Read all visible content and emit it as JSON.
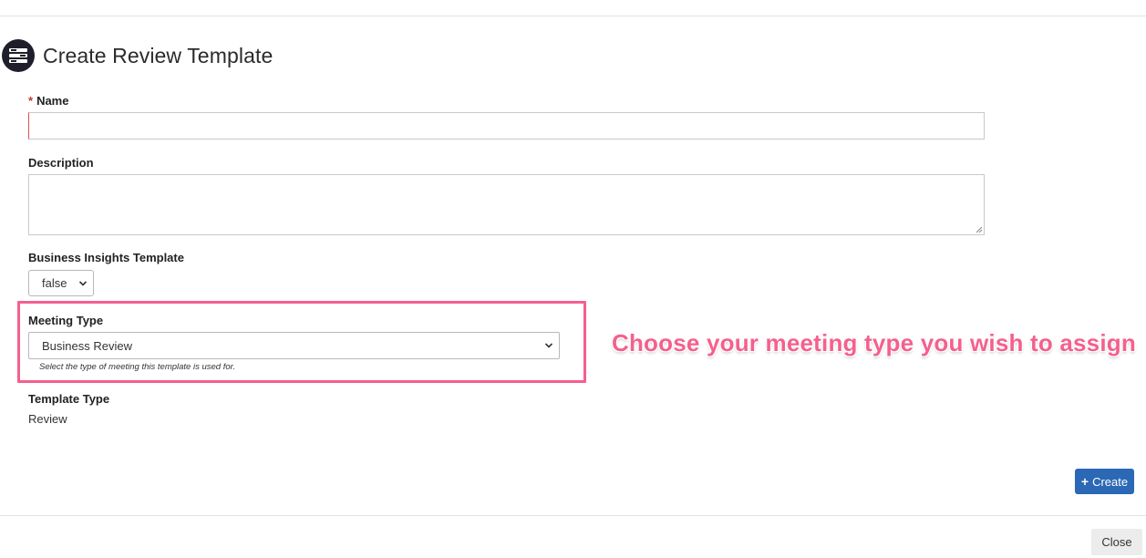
{
  "header": {
    "title": "Create Review Template",
    "icon": "list-stack-icon"
  },
  "form": {
    "name": {
      "required_marker": "*",
      "label": "Name",
      "value": ""
    },
    "description": {
      "label": "Description",
      "value": ""
    },
    "business_insights": {
      "label": "Business Insights Template",
      "selected": "false"
    },
    "meeting_type": {
      "label": "Meeting Type",
      "selected": "Business Review",
      "help": "Select the type of meeting this template is used for."
    },
    "template_type": {
      "label": "Template Type",
      "value": "Review"
    }
  },
  "annotation": {
    "text": "Choose your meeting type you wish to assign",
    "color": "#f4608e"
  },
  "actions": {
    "create_label": "Create",
    "close_label": "Close",
    "create_color": "#2b68b5"
  }
}
